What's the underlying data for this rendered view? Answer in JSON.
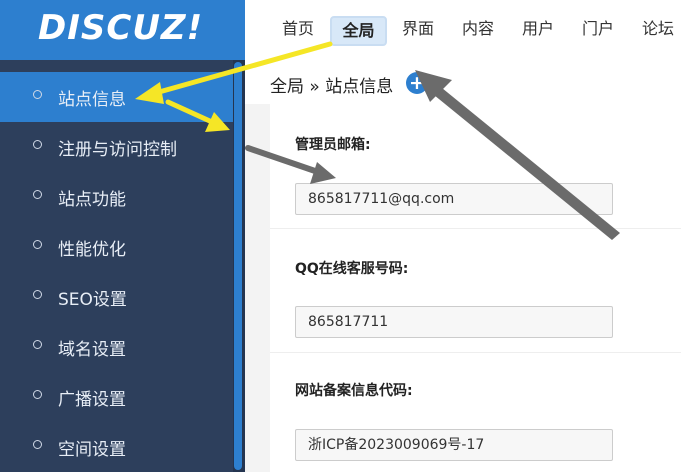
{
  "logo": {
    "text": "DISCUZ!"
  },
  "sidebar": {
    "items": [
      {
        "label": "站点信息",
        "active": true
      },
      {
        "label": "注册与访问控制"
      },
      {
        "label": "站点功能"
      },
      {
        "label": "性能优化"
      },
      {
        "label": "SEO设置"
      },
      {
        "label": "域名设置"
      },
      {
        "label": "广播设置"
      },
      {
        "label": "空间设置"
      }
    ]
  },
  "topnav": {
    "items": [
      {
        "label": "首页"
      },
      {
        "label": "全局",
        "active": true
      },
      {
        "label": "界面"
      },
      {
        "label": "内容"
      },
      {
        "label": "用户"
      },
      {
        "label": "门户"
      },
      {
        "label": "论坛"
      }
    ]
  },
  "breadcrumb": {
    "text": "全局 » 站点信息"
  },
  "form": {
    "admin_email": {
      "label": "管理员邮箱:",
      "value": "865817711@qq.com"
    },
    "qq_service": {
      "label": "QQ在线客服号码:",
      "value": "865817711"
    },
    "icp": {
      "label": "网站备案信息代码:",
      "value": "浙ICP备2023009069号-17"
    }
  },
  "colors": {
    "accent": "#2d7fcf",
    "sidebar_bg": "#2d3f5c",
    "annotation_yellow": "#f5e626",
    "annotation_gray": "#6b6b6b"
  },
  "icons": [
    "add-icon"
  ]
}
